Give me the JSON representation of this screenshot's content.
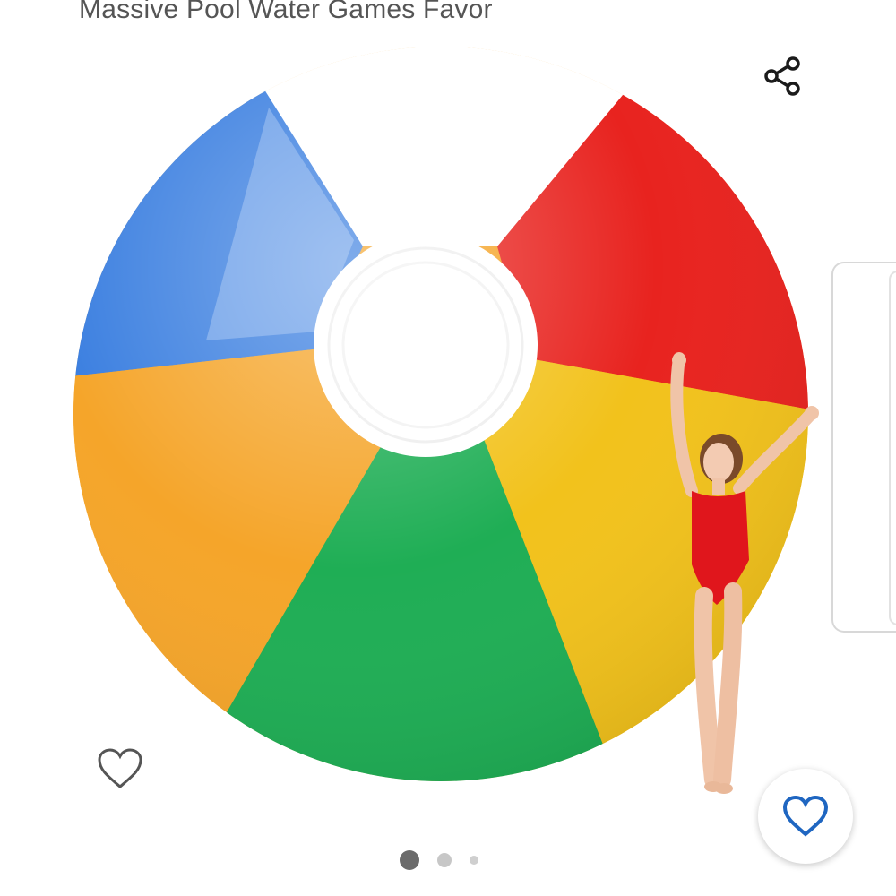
{
  "product": {
    "title": "Massive Pool Water Games Favor"
  },
  "icons": {
    "share": "share-icon",
    "wishlist": "heart-outline-icon",
    "wishlist_fab": "heart-icon"
  },
  "colors": {
    "accent_blue": "#1f66c1",
    "icon_dark": "#1b1b1b",
    "heart_outline": "#555555",
    "ball_blue": "#3b7fe0",
    "ball_red": "#e8231f",
    "ball_orange": "#f5a52a",
    "ball_green": "#1fae55",
    "ball_yellow": "#f2c21c",
    "swimsuit_red": "#e0161c"
  },
  "carousel": {
    "total": 3,
    "active_index": 1
  }
}
